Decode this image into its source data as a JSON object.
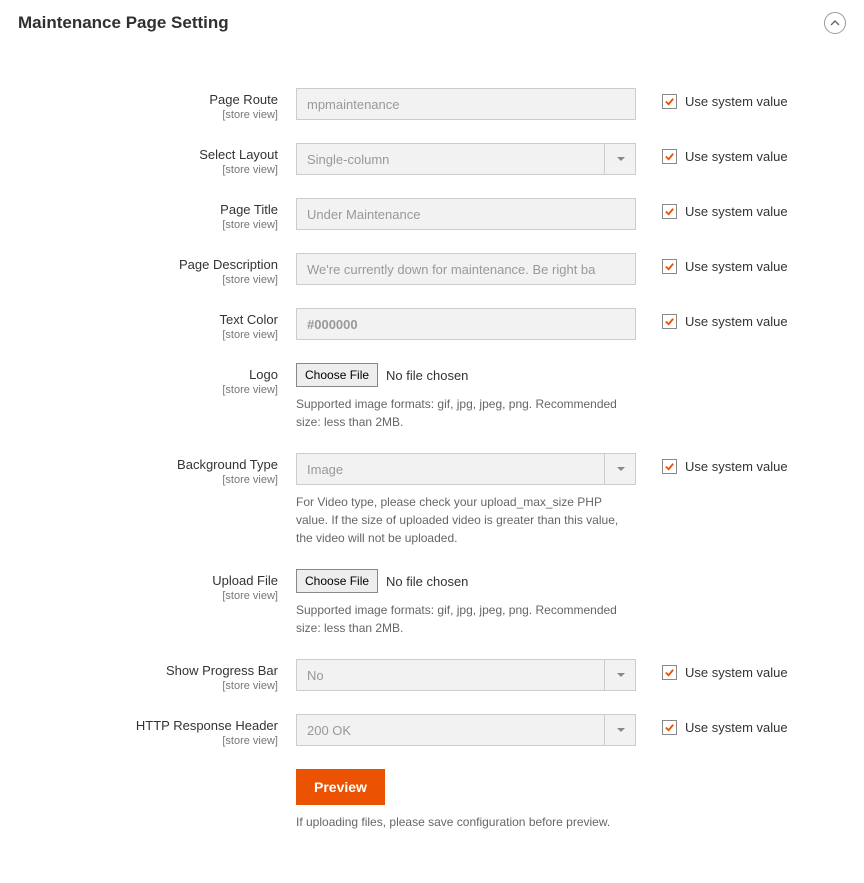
{
  "section": {
    "title": "Maintenance Page Setting"
  },
  "scope_label": "[store view]",
  "use_system_label": "Use system value",
  "no_file_label": "No file chosen",
  "choose_file_label": "Choose File",
  "fields": {
    "page_route": {
      "label": "Page Route",
      "value": "mpmaintenance"
    },
    "select_layout": {
      "label": "Select Layout",
      "value": "Single-column"
    },
    "page_title": {
      "label": "Page Title",
      "value": "Under Maintenance"
    },
    "page_description": {
      "label": "Page Description",
      "value": "We're currently down for maintenance. Be right ba"
    },
    "text_color": {
      "label": "Text Color",
      "value": "#000000"
    },
    "logo": {
      "label": "Logo",
      "note": "Supported image formats: gif, jpg, jpeg, png. Recommended size: less than 2MB."
    },
    "background_type": {
      "label": "Background Type",
      "value": "Image",
      "note": "For Video type, please check your upload_max_size PHP value. If the size of uploaded video is greater than this value, the video will not be uploaded."
    },
    "upload_file": {
      "label": "Upload File",
      "note": "Supported image formats: gif, jpg, jpeg, png. Recommended size: less than 2MB."
    },
    "show_progress": {
      "label": "Show Progress Bar",
      "value": "No"
    },
    "http_header": {
      "label": "HTTP Response Header",
      "value": "200 OK"
    }
  },
  "preview": {
    "label": "Preview",
    "note": "If uploading files, please save configuration before preview."
  }
}
